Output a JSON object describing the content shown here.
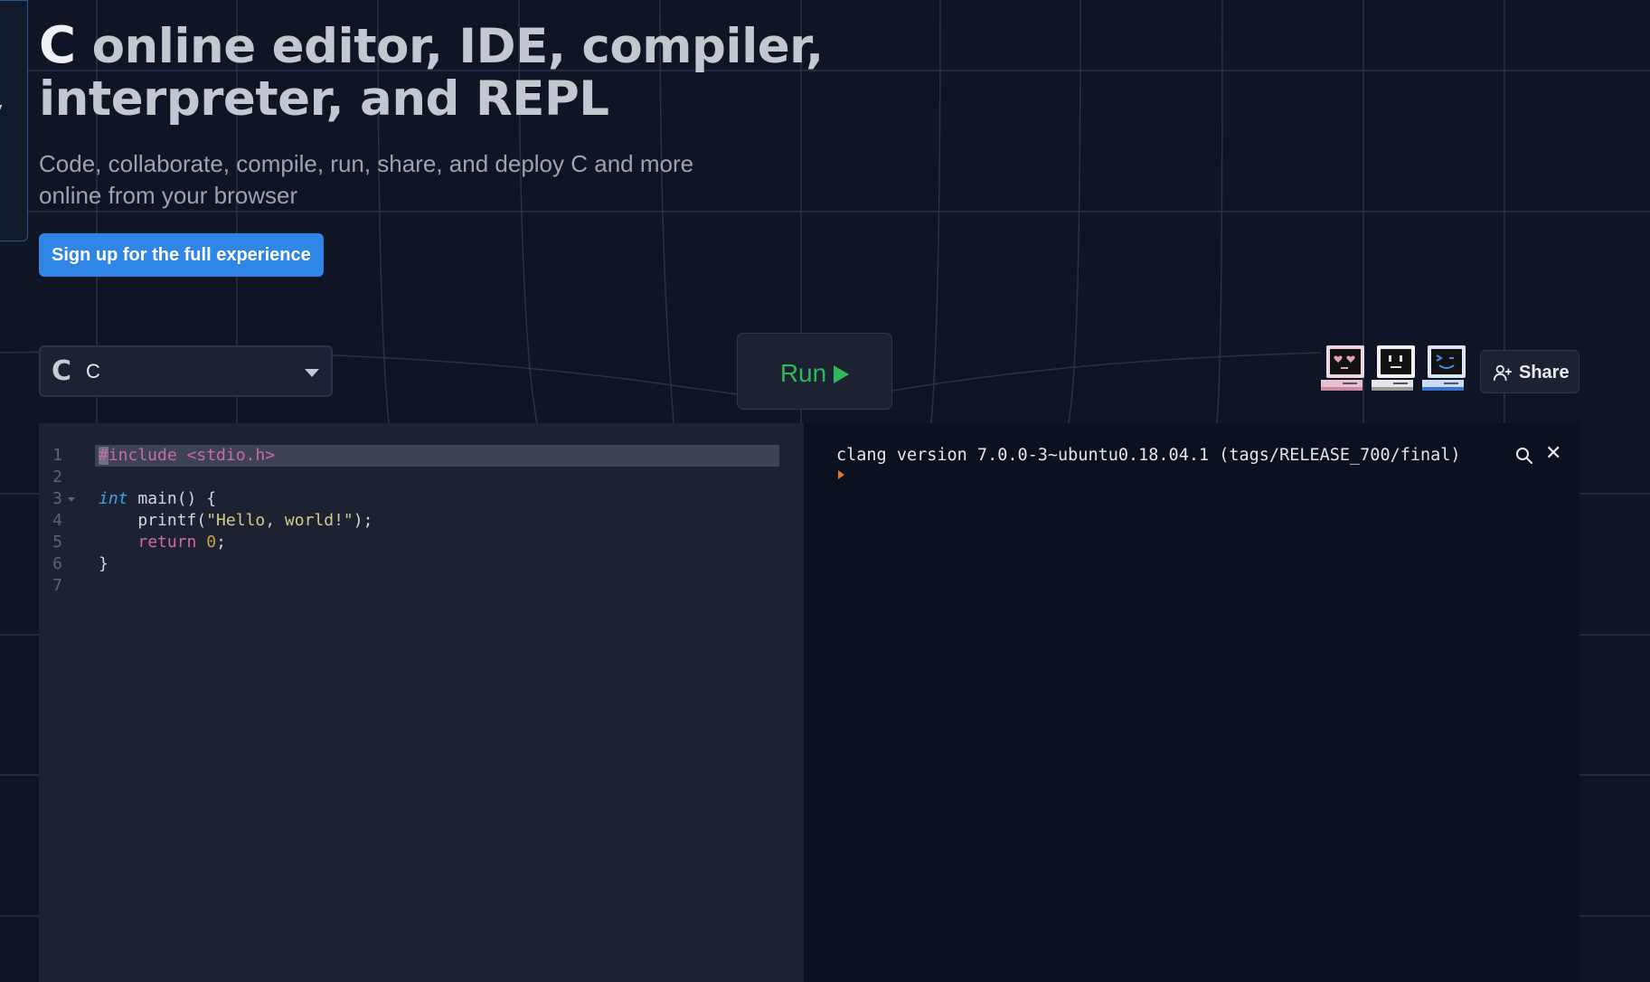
{
  "sidebar_edge": {
    "chars": [
      "r",
      "y"
    ]
  },
  "hero": {
    "c_mark": "C",
    "title": "online editor, IDE, compiler,",
    "title_line2": "interpreter, and REPL",
    "subtitle_line1": "Code, collaborate, compile, run, share, and deploy C and more",
    "subtitle_line2": "online from your browser",
    "signup_label": "Sign up for the full experience"
  },
  "toolbar": {
    "language_icon": "C",
    "language": "C",
    "run_label": "Run",
    "share_label": "Share",
    "avatars": [
      "heart-eyes-computer-icon",
      "neutral-face-computer-icon",
      "smile-face-computer-icon"
    ]
  },
  "editor": {
    "lines": [
      {
        "num": "1",
        "code": "#include <stdio.h>"
      },
      {
        "num": "2",
        "code": ""
      },
      {
        "num": "3",
        "code": "int main() {"
      },
      {
        "num": "4",
        "code": "    printf(\"Hello, world!\");"
      },
      {
        "num": "5",
        "code": "    return 0;"
      },
      {
        "num": "6",
        "code": "}"
      },
      {
        "num": "7",
        "code": ""
      }
    ]
  },
  "console": {
    "banner": "clang version 7.0.0-3~ubuntu0.18.04.1 (tags/RELEASE_700/final)"
  },
  "colors": {
    "background": "#0f1524",
    "accent_blue": "#2f86e6",
    "run_green": "#2fb85a",
    "prompt_orange": "#e6752c"
  }
}
